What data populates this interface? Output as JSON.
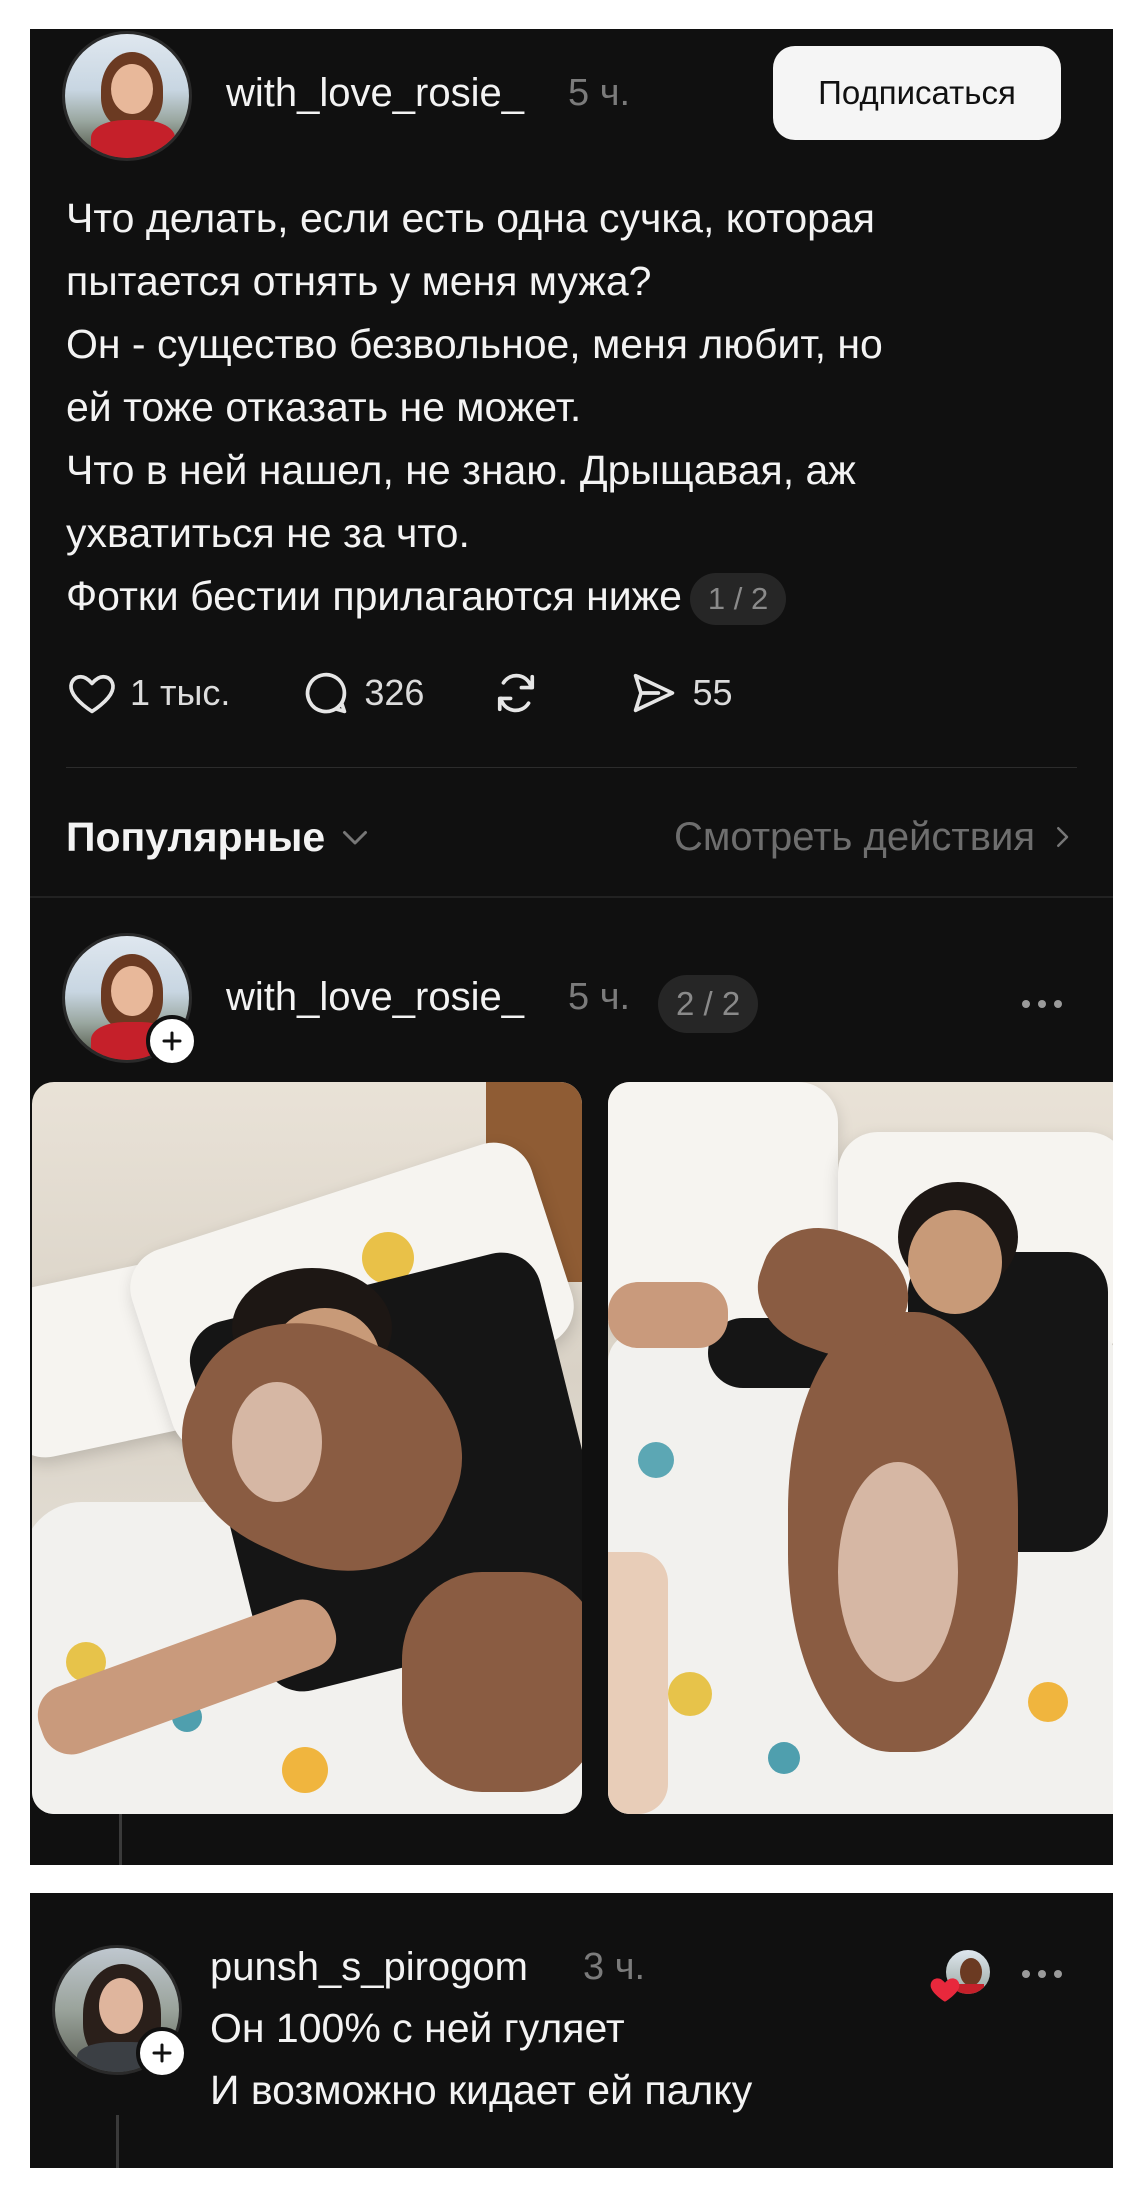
{
  "post": {
    "username": "with_love_rosie_",
    "time": "5 ч.",
    "follow_label": "Подписаться",
    "text_lines": [
      "Что делать, если есть одна сучка, которая",
      "пытается отнять у меня мужа?",
      "Он - существо безвольное, меня любит, но",
      "ей тоже отказать не может.",
      "Что в ней нашел, не знаю. Дрыщавая, аж",
      "ухватиться не за что.",
      "Фотки бестии прилагаются ниже"
    ],
    "pager": "1 / 2",
    "likes": "1 тыс.",
    "comments": "326",
    "shares": "55"
  },
  "sort": {
    "label": "Популярные",
    "view_activity": "Смотреть действия"
  },
  "reply": {
    "username": "with_love_rosie_",
    "time": "5 ч.",
    "pager": "2 / 2"
  },
  "comment": {
    "username": "punsh_s_pirogom",
    "time": "3 ч.",
    "lines": [
      "Он 100% с ней гуляет",
      "И возможно кидает ей палку"
    ]
  },
  "colors": {
    "background": "#101010",
    "like_heart": "#e8283c"
  },
  "icons": [
    "heart-icon",
    "comment-icon",
    "repost-icon",
    "send-icon",
    "chevron-down-icon",
    "chevron-right-icon",
    "more-icon",
    "plus-icon"
  ]
}
